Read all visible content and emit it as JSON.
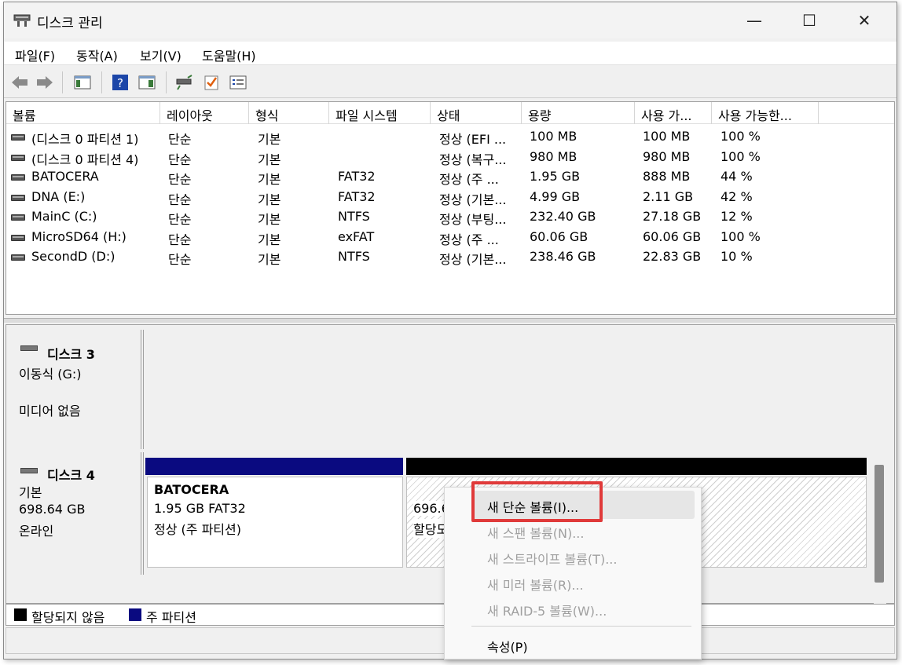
{
  "window": {
    "title": "디스크 관리",
    "min_symbol": "—",
    "max_symbol": "☐",
    "close_symbol": "✕"
  },
  "menu": {
    "file": "파일(F)",
    "action": "동작(A)",
    "view": "보기(V)",
    "help": "도움말(H)"
  },
  "toolbar_icons": [
    "back-icon",
    "forward-icon",
    "console-tree-icon",
    "help-icon",
    "show-pane-icon",
    "connect-disk-icon",
    "check-icon",
    "properties-list-icon"
  ],
  "volume_list": {
    "headers": [
      "볼륨",
      "레이아웃",
      "형식",
      "파일 시스템",
      "상태",
      "용량",
      "사용 가...",
      "사용 가능한..."
    ],
    "rows": [
      [
        "(디스크 0 파티션 1)",
        "단순",
        "기본",
        "",
        "정상 (EFI ...",
        "100 MB",
        "100 MB",
        "100 %"
      ],
      [
        "(디스크 0 파티션 4)",
        "단순",
        "기본",
        "",
        "정상 (복구...",
        "980 MB",
        "980 MB",
        "100 %"
      ],
      [
        "BATOCERA",
        "단순",
        "기본",
        "FAT32",
        "정상 (주 ...",
        "1.95 GB",
        "888 MB",
        "44 %"
      ],
      [
        "DNA (E:)",
        "단순",
        "기본",
        "FAT32",
        "정상 (기본...",
        "4.99 GB",
        "2.11 GB",
        "42 %"
      ],
      [
        "MainC (C:)",
        "단순",
        "기본",
        "NTFS",
        "정상 (부팅...",
        "232.40 GB",
        "27.18 GB",
        "12 %"
      ],
      [
        "MicroSD64 (H:)",
        "단순",
        "기본",
        "exFAT",
        "정상 (주 ...",
        "60.06 GB",
        "60.06 GB",
        "100 %"
      ],
      [
        "SecondD (D:)",
        "단순",
        "기본",
        "NTFS",
        "정상 (기본...",
        "238.46 GB",
        "22.83 GB",
        "10 %"
      ]
    ]
  },
  "disk3": {
    "title": "디스크 3",
    "type": "이동식 (G:)",
    "media": "미디어 없음"
  },
  "disk4": {
    "title": "디스크 4",
    "type": "기본",
    "size": "698.64 GB",
    "status": "온라인",
    "partition": {
      "name": "BATOCERA",
      "info": "1.95 GB FAT32",
      "status": "정상 (주 파티션)"
    },
    "unallocated": {
      "size": "696.6",
      "label": "할당도"
    }
  },
  "legend": {
    "unallocated": "할당되지 않음",
    "primary": "주 파티션",
    "unallocated_color": "#000000",
    "primary_color": "#0a0a80"
  },
  "context_menu": {
    "new_simple": "새 단순 볼륨(I)...",
    "new_spanned": "새 스팬 볼륨(N)...",
    "new_striped": "새 스트라이프 볼륨(T)...",
    "new_mirror": "새 미러 볼륨(R)...",
    "new_raid5": "새 RAID-5 볼륨(W)...",
    "properties": "속성(P)"
  },
  "highlight_color": "#e03a3a"
}
